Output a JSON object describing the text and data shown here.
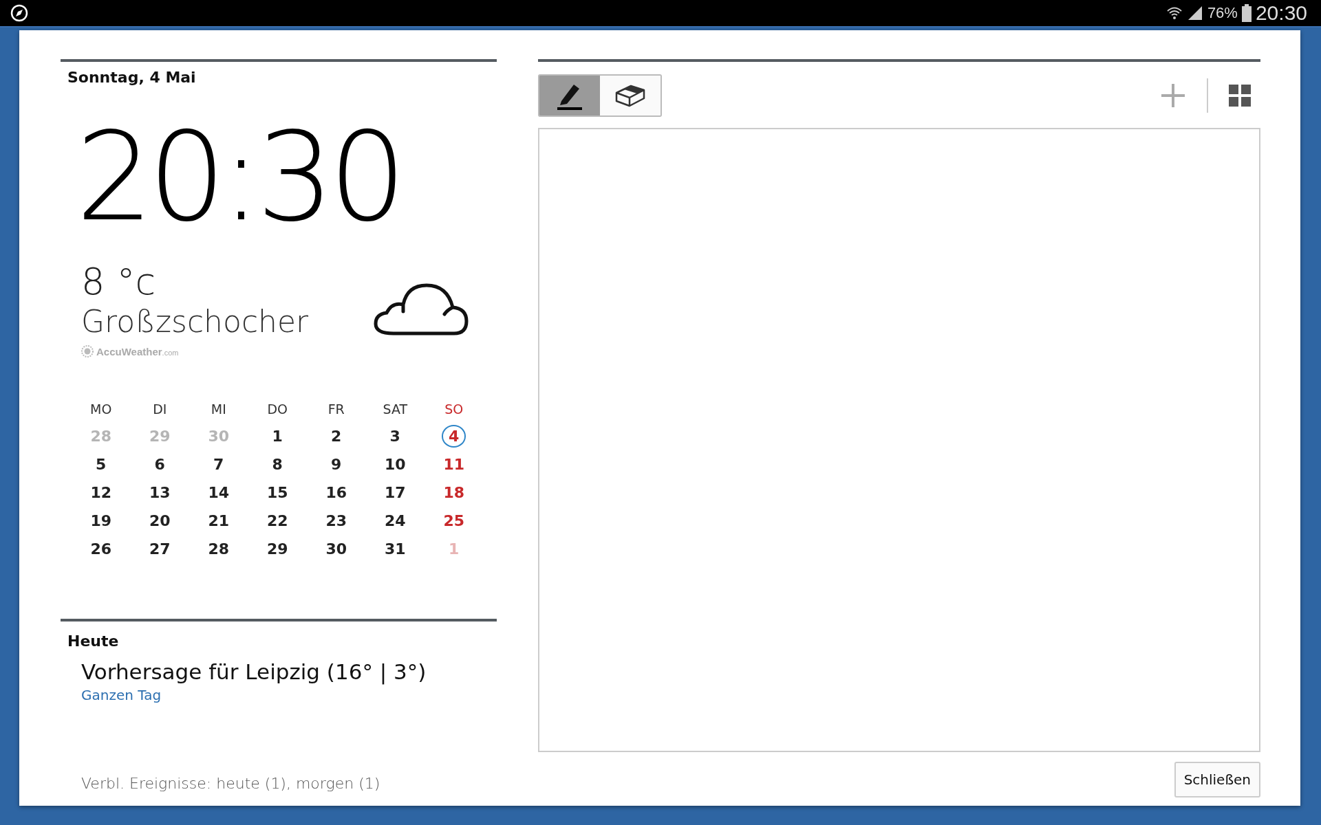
{
  "status_bar": {
    "battery": "76%",
    "time": "20:30"
  },
  "clock": {
    "date": "Sonntag, 4 Mai",
    "time": "20:30"
  },
  "weather": {
    "temperature": "8",
    "unit": "°c",
    "location": "Großzschocher",
    "provider": "AccuWeather",
    "provider_suffix": ".com"
  },
  "calendar": {
    "columns": [
      {
        "label": "MO",
        "sunday": false
      },
      {
        "label": "DI",
        "sunday": false
      },
      {
        "label": "MI",
        "sunday": false
      },
      {
        "label": "DO",
        "sunday": false
      },
      {
        "label": "FR",
        "sunday": false
      },
      {
        "label": "SAT",
        "sunday": false
      },
      {
        "label": "SO",
        "sunday": true
      }
    ],
    "weeks": [
      [
        {
          "label": "28",
          "outside": true,
          "selected": false
        },
        {
          "label": "29",
          "outside": true,
          "selected": false
        },
        {
          "label": "30",
          "outside": true,
          "selected": false
        },
        {
          "label": "1",
          "outside": false,
          "selected": false
        },
        {
          "label": "2",
          "outside": false,
          "selected": false
        },
        {
          "label": "3",
          "outside": false,
          "selected": false
        },
        {
          "label": "4",
          "outside": false,
          "selected": true
        }
      ],
      [
        {
          "label": "5",
          "outside": false,
          "selected": false
        },
        {
          "label": "6",
          "outside": false,
          "selected": false
        },
        {
          "label": "7",
          "outside": false,
          "selected": false
        },
        {
          "label": "8",
          "outside": false,
          "selected": false
        },
        {
          "label": "9",
          "outside": false,
          "selected": false
        },
        {
          "label": "10",
          "outside": false,
          "selected": false
        },
        {
          "label": "11",
          "outside": false,
          "selected": false
        }
      ],
      [
        {
          "label": "12",
          "outside": false,
          "selected": false
        },
        {
          "label": "13",
          "outside": false,
          "selected": false
        },
        {
          "label": "14",
          "outside": false,
          "selected": false
        },
        {
          "label": "15",
          "outside": false,
          "selected": false
        },
        {
          "label": "16",
          "outside": false,
          "selected": false
        },
        {
          "label": "17",
          "outside": false,
          "selected": false
        },
        {
          "label": "18",
          "outside": false,
          "selected": false
        }
      ],
      [
        {
          "label": "19",
          "outside": false,
          "selected": false
        },
        {
          "label": "20",
          "outside": false,
          "selected": false
        },
        {
          "label": "21",
          "outside": false,
          "selected": false
        },
        {
          "label": "22",
          "outside": false,
          "selected": false
        },
        {
          "label": "23",
          "outside": false,
          "selected": false
        },
        {
          "label": "24",
          "outside": false,
          "selected": false
        },
        {
          "label": "25",
          "outside": false,
          "selected": false
        }
      ],
      [
        {
          "label": "26",
          "outside": false,
          "selected": false
        },
        {
          "label": "27",
          "outside": false,
          "selected": false
        },
        {
          "label": "28",
          "outside": false,
          "selected": false
        },
        {
          "label": "29",
          "outside": false,
          "selected": false
        },
        {
          "label": "30",
          "outside": false,
          "selected": false
        },
        {
          "label": "31",
          "outside": false,
          "selected": false
        },
        {
          "label": "1",
          "outside": true,
          "selected": false
        }
      ]
    ]
  },
  "today": {
    "heading": "Heute",
    "event": "Vorhersage für Leipzig (16° | 3°)",
    "time": "Ganzen Tag"
  },
  "remaining_events": "Verbl. Ereignisse: heute (1), morgen (1)",
  "memo": {
    "tools": [
      {
        "kind": "pen",
        "selected": true
      },
      {
        "kind": "eraser",
        "selected": false
      }
    ]
  },
  "close_button": "Schließen"
}
